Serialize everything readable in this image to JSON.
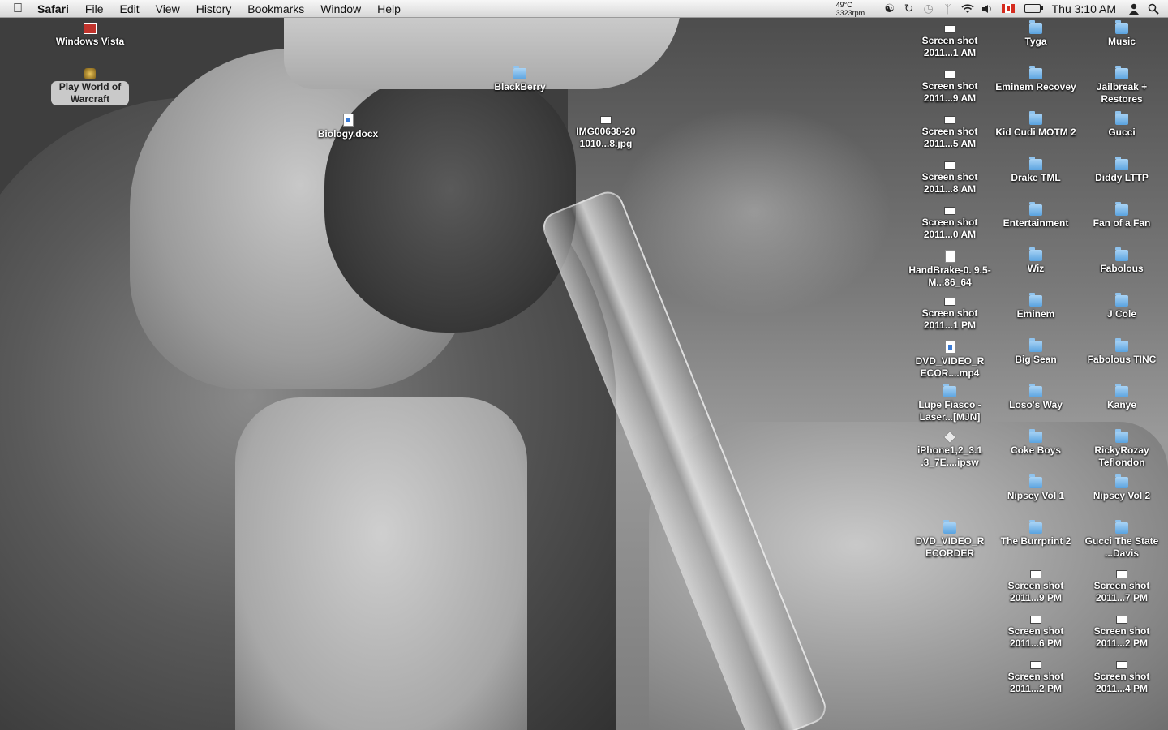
{
  "menubar": {
    "app_name": "Safari",
    "menus": [
      "File",
      "Edit",
      "View",
      "History",
      "Bookmarks",
      "Window",
      "Help"
    ],
    "temperature": "49°C",
    "fan_speed": "3323rpm",
    "clock": "Thu 3:10 AM"
  },
  "desktop": {
    "left_icons": [
      {
        "label": "Windows Vista",
        "icon": "windows-vista-app-icon"
      },
      {
        "label": "Play World of Warcraft",
        "icon": "warcraft-app-icon"
      }
    ],
    "scattered_icons": [
      {
        "label": "BlackBerry",
        "icon": "folder-icon"
      },
      {
        "label": "Biology.docx",
        "icon": "document-icon"
      },
      {
        "label": "IMG00638-20 1010...8.jpg",
        "icon": "image-file-icon"
      }
    ],
    "column_1": [
      {
        "label": "Screen shot 2011...1 AM",
        "icon": "screenshot-file-icon"
      },
      {
        "label": "Screen shot 2011...9 AM",
        "icon": "screenshot-file-icon"
      },
      {
        "label": "Screen shot 2011...5 AM",
        "icon": "screenshot-file-icon"
      },
      {
        "label": "Screen shot 2011...8 AM",
        "icon": "screenshot-file-icon"
      },
      {
        "label": "Screen shot 2011...0 AM",
        "icon": "screenshot-file-icon"
      },
      {
        "label": "HandBrake-0. 9.5-M...86_64",
        "icon": "document-icon"
      },
      {
        "label": "Screen shot 2011...1 PM",
        "icon": "screenshot-file-icon"
      },
      {
        "label": "DVD_VIDEO_R ECOR....mp4",
        "icon": "video-file-icon"
      },
      {
        "label": "Lupe Fiasco - Laser...[MJN]",
        "icon": "folder-icon"
      },
      {
        "label": "iPhone1,2_3.1 .3_7E....ipsw",
        "icon": "ipsw-file-icon"
      },
      {
        "label": "",
        "icon": ""
      },
      {
        "label": "DVD_VIDEO_R ECORDER",
        "icon": "folder-icon"
      }
    ],
    "column_2": [
      {
        "label": "Tyga",
        "icon": "folder-icon"
      },
      {
        "label": "Eminem Recovey",
        "icon": "folder-icon"
      },
      {
        "label": "Kid Cudi MOTM 2",
        "icon": "folder-icon"
      },
      {
        "label": "Drake TML",
        "icon": "folder-icon"
      },
      {
        "label": "Entertainment",
        "icon": "folder-icon"
      },
      {
        "label": "Wiz",
        "icon": "folder-icon"
      },
      {
        "label": "Eminem",
        "icon": "folder-icon"
      },
      {
        "label": "Big Sean",
        "icon": "folder-icon"
      },
      {
        "label": "Loso's Way",
        "icon": "folder-icon"
      },
      {
        "label": "Coke Boys",
        "icon": "folder-icon"
      },
      {
        "label": "Nipsey Vol 1",
        "icon": "folder-icon"
      },
      {
        "label": "The Burrprint 2",
        "icon": "folder-icon"
      },
      {
        "label": "Screen shot 2011...9 PM",
        "icon": "screenshot-file-icon"
      },
      {
        "label": "Screen shot 2011...6 PM",
        "icon": "screenshot-file-icon"
      },
      {
        "label": "Screen shot 2011...2 PM",
        "icon": "screenshot-file-icon"
      }
    ],
    "column_3": [
      {
        "label": "Music",
        "icon": "folder-icon"
      },
      {
        "label": "Jailbreak + Restores",
        "icon": "folder-icon"
      },
      {
        "label": "Gucci",
        "icon": "folder-icon"
      },
      {
        "label": "Diddy LTTP",
        "icon": "folder-icon"
      },
      {
        "label": "Fan of a Fan",
        "icon": "folder-icon"
      },
      {
        "label": "Fabolous",
        "icon": "folder-icon"
      },
      {
        "label": "J Cole",
        "icon": "folder-icon"
      },
      {
        "label": "Fabolous TINC",
        "icon": "folder-icon"
      },
      {
        "label": "Kanye",
        "icon": "folder-icon"
      },
      {
        "label": "RickyRozay Teflondon",
        "icon": "folder-icon"
      },
      {
        "label": "Nipsey Vol 2",
        "icon": "folder-icon"
      },
      {
        "label": "Gucci The State ...Davis",
        "icon": "folder-icon"
      },
      {
        "label": "Screen shot 2011...7 PM",
        "icon": "screenshot-file-icon"
      },
      {
        "label": "Screen shot 2011...2 PM",
        "icon": "screenshot-file-icon"
      },
      {
        "label": "Screen shot 2011...4 PM",
        "icon": "screenshot-file-icon"
      }
    ]
  }
}
